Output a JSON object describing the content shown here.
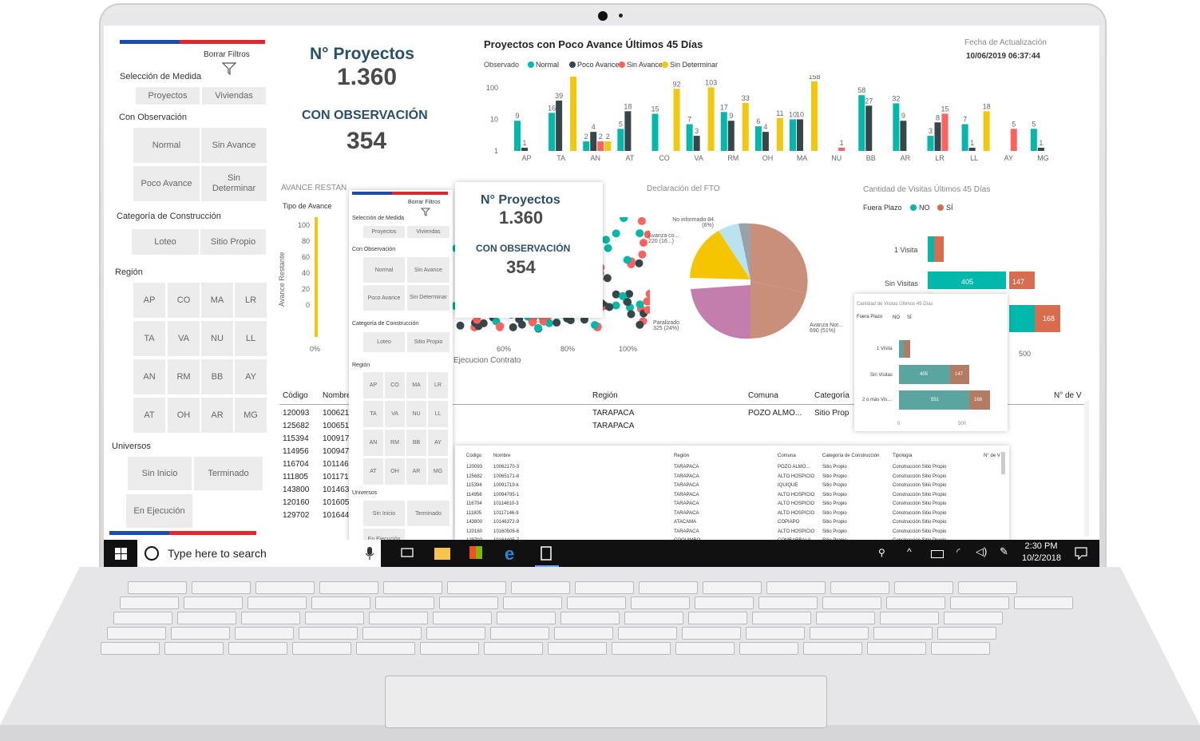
{
  "sidebar": {
    "clear_filters": "Borrar Filtros",
    "measure_title": "Selección de Medida",
    "measure_options": [
      "Proyectos",
      "Viviendas"
    ],
    "observation_title": "Con Observación",
    "observation_options": [
      "Normal",
      "Sin Avance",
      "Poco Avance",
      "Sin Determinar"
    ],
    "category_title": "Categoría de Construcción",
    "category_options": [
      "Loteo",
      "Sitio Propio"
    ],
    "region_title": "Región",
    "regions": [
      "AP",
      "CO",
      "MA",
      "LR",
      "TA",
      "VA",
      "NU",
      "LL",
      "AN",
      "RM",
      "BB",
      "AY",
      "AT",
      "OH",
      "AR",
      "MG"
    ],
    "universe_title": "Universos",
    "universe_options": [
      "Sin Inicio",
      "Terminado",
      "En Ejecución"
    ]
  },
  "kpi": {
    "projects_label": "N° Proyectos",
    "projects_value": "1.360",
    "observation_label": "CON OBSERVACIÓN",
    "observation_value": "354"
  },
  "update": {
    "label": "Fecha de Actualización",
    "value": "10/06/2019 06:37:44"
  },
  "legend": {
    "prefix": "Observado",
    "items": [
      {
        "name": "Normal",
        "color": "#01b8aa"
      },
      {
        "name": "Poco Avance",
        "color": "#374649"
      },
      {
        "name": "Sin Avance",
        "color": "#fd625e"
      },
      {
        "name": "Sin Determinar",
        "color": "#f2c80f"
      }
    ]
  },
  "visits": {
    "title": "Cantidad de Visitas Últimos 45 Días",
    "legend_prefix": "Fuera Plazo",
    "legend_no": "NO",
    "legend_si": "SÍ",
    "row1": "1 Visita",
    "row2": "Sin Visitas",
    "row3": "2 o más Vis...",
    "v405": "405",
    "v147": "147",
    "v168": "168",
    "v551": "551",
    "tick500": "500",
    "tick0": "0"
  },
  "fto": {
    "title": "Declaración del FTO",
    "labels": [
      "No informado 84 (6%)",
      "Avanza co... 220 (16...)",
      "Paralizado 325 (24%)",
      "Avanza Nor... 690 (51%)"
    ]
  },
  "scatter": {
    "title": "AVANCE RESTAN",
    "legend": "Tipo de Avance",
    "ylabel": "Avance Restante",
    "yticks": [
      "100",
      "80",
      "60",
      "40",
      "20",
      "0"
    ],
    "xticks": [
      "0%",
      "60%",
      "80%",
      "100%"
    ],
    "xlabel": "Ejecucion Contrato"
  },
  "table": {
    "headers": [
      "Código",
      "Nombre",
      "Región",
      "Comuna",
      "Categoría",
      "Tipología",
      "N° de V"
    ],
    "codes": [
      "120093",
      "125682",
      "115394",
      "114956",
      "116704",
      "111805",
      "143800",
      "120160",
      "129702"
    ],
    "names": [
      "100621",
      "100651",
      "100917",
      "100947",
      "101146",
      "101171",
      "101463",
      "101605",
      "101644"
    ],
    "regions": [
      "TARAPACA",
      "TARAPACA"
    ],
    "comunas": [
      "POZO ALMO..."
    ],
    "cats": [
      "Sitio Prop"
    ]
  },
  "small_table": {
    "rows": [
      [
        "120093",
        "10062170-3",
        "TARAPACA",
        "POZO ALMO...",
        "Sitio Propio",
        "Construcción Sitio Propio"
      ],
      [
        "125682",
        "10065171-8",
        "TARAPACA",
        "ALTO HOSPICIO",
        "Sitio Propio",
        "Construcción Sitio Propio"
      ],
      [
        "115394",
        "10091719-k",
        "TARAPACA",
        "IQUIQUE",
        "Sitio Propio",
        "Construcción Sitio Propio"
      ],
      [
        "114956",
        "10094795-1",
        "TARAPACA",
        "ALTO HOSPICIO",
        "Sitio Propio",
        "Construcción Sitio Propio"
      ],
      [
        "116704",
        "10114610-3",
        "TARAPACA",
        "ALTO HOSPICIO",
        "Sitio Propio",
        "Construcción Sitio Propio"
      ],
      [
        "111805",
        "10117146-9",
        "TARAPACA",
        "ALTO HOSPICIO",
        "Sitio Propio",
        "Construcción Sitio Propio"
      ],
      [
        "143800",
        "10146372-9",
        "ATACAMA",
        "COPIAPO",
        "Sitio Propio",
        "Construcción Sitio Propio"
      ],
      [
        "120160",
        "10160508-6",
        "TARAPACA",
        "ALTO HOSPICIO",
        "Sitio Propio",
        "Construcción Sitio Propio"
      ],
      [
        "129702",
        "10164405-7",
        "COQUIMBO",
        "COMBARBALA",
        "Sitio Propio",
        "Construcción Sitio Propio"
      ]
    ],
    "headers": [
      "Código",
      "Nombre",
      "Región",
      "Comuna",
      "Categoría de Construcción",
      "Tipología",
      "N° de V"
    ]
  },
  "taskbar": {
    "search": "Type here to search",
    "time": "2:30 PM",
    "date": "10/2/2018"
  },
  "chart_data": {
    "type": "bar",
    "title": "Proyectos con Poco Avance Últimos 45 Días",
    "scale": "log",
    "yticks": [
      1,
      10,
      100
    ],
    "categories": [
      "AP",
      "TA",
      "AN",
      "AT",
      "CO",
      "VA",
      "RM",
      "OH",
      "MA",
      "NU",
      "BB",
      "AR",
      "LR",
      "LL",
      "AY",
      "MG"
    ],
    "series": [
      {
        "name": "Normal",
        "values": [
          9,
          16,
          2,
          5,
          15,
          7,
          17,
          6,
          10,
          0,
          58,
          32,
          3,
          7,
          0,
          5
        ]
      },
      {
        "name": "Poco Avance",
        "values": [
          1,
          39,
          4,
          18,
          0,
          3,
          9,
          4,
          10,
          0,
          27,
          9,
          8,
          1,
          0,
          1
        ]
      },
      {
        "name": "Sin Avance",
        "values": [
          0,
          0,
          2,
          0,
          0,
          0,
          0,
          0,
          0,
          1,
          0,
          0,
          15,
          0,
          5,
          0
        ]
      },
      {
        "name": "Sin Determinar",
        "values": [
          0,
          225,
          2,
          0,
          92,
          103,
          33,
          11,
          158,
          0,
          0,
          0,
          0,
          18,
          0,
          0
        ]
      }
    ]
  }
}
